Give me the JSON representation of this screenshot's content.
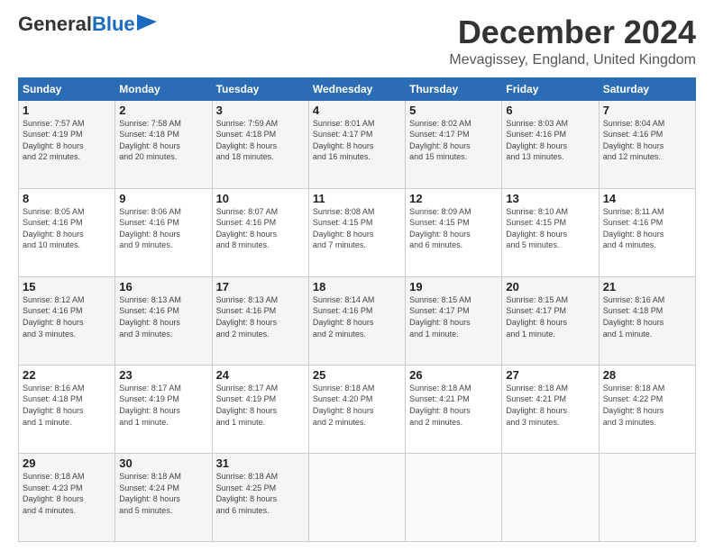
{
  "header": {
    "logo": {
      "general": "General",
      "blue": "Blue",
      "tagline": ""
    },
    "title": "December 2024",
    "location": "Mevagissey, England, United Kingdom"
  },
  "calendar": {
    "headers": [
      "Sunday",
      "Monday",
      "Tuesday",
      "Wednesday",
      "Thursday",
      "Friday",
      "Saturday"
    ],
    "weeks": [
      [
        {
          "day": "1",
          "info": "Sunrise: 7:57 AM\nSunset: 4:19 PM\nDaylight: 8 hours\nand 22 minutes."
        },
        {
          "day": "2",
          "info": "Sunrise: 7:58 AM\nSunset: 4:18 PM\nDaylight: 8 hours\nand 20 minutes."
        },
        {
          "day": "3",
          "info": "Sunrise: 7:59 AM\nSunset: 4:18 PM\nDaylight: 8 hours\nand 18 minutes."
        },
        {
          "day": "4",
          "info": "Sunrise: 8:01 AM\nSunset: 4:17 PM\nDaylight: 8 hours\nand 16 minutes."
        },
        {
          "day": "5",
          "info": "Sunrise: 8:02 AM\nSunset: 4:17 PM\nDaylight: 8 hours\nand 15 minutes."
        },
        {
          "day": "6",
          "info": "Sunrise: 8:03 AM\nSunset: 4:16 PM\nDaylight: 8 hours\nand 13 minutes."
        },
        {
          "day": "7",
          "info": "Sunrise: 8:04 AM\nSunset: 4:16 PM\nDaylight: 8 hours\nand 12 minutes."
        }
      ],
      [
        {
          "day": "8",
          "info": "Sunrise: 8:05 AM\nSunset: 4:16 PM\nDaylight: 8 hours\nand 10 minutes."
        },
        {
          "day": "9",
          "info": "Sunrise: 8:06 AM\nSunset: 4:16 PM\nDaylight: 8 hours\nand 9 minutes."
        },
        {
          "day": "10",
          "info": "Sunrise: 8:07 AM\nSunset: 4:16 PM\nDaylight: 8 hours\nand 8 minutes."
        },
        {
          "day": "11",
          "info": "Sunrise: 8:08 AM\nSunset: 4:15 PM\nDaylight: 8 hours\nand 7 minutes."
        },
        {
          "day": "12",
          "info": "Sunrise: 8:09 AM\nSunset: 4:15 PM\nDaylight: 8 hours\nand 6 minutes."
        },
        {
          "day": "13",
          "info": "Sunrise: 8:10 AM\nSunset: 4:15 PM\nDaylight: 8 hours\nand 5 minutes."
        },
        {
          "day": "14",
          "info": "Sunrise: 8:11 AM\nSunset: 4:16 PM\nDaylight: 8 hours\nand 4 minutes."
        }
      ],
      [
        {
          "day": "15",
          "info": "Sunrise: 8:12 AM\nSunset: 4:16 PM\nDaylight: 8 hours\nand 3 minutes."
        },
        {
          "day": "16",
          "info": "Sunrise: 8:13 AM\nSunset: 4:16 PM\nDaylight: 8 hours\nand 3 minutes."
        },
        {
          "day": "17",
          "info": "Sunrise: 8:13 AM\nSunset: 4:16 PM\nDaylight: 8 hours\nand 2 minutes."
        },
        {
          "day": "18",
          "info": "Sunrise: 8:14 AM\nSunset: 4:16 PM\nDaylight: 8 hours\nand 2 minutes."
        },
        {
          "day": "19",
          "info": "Sunrise: 8:15 AM\nSunset: 4:17 PM\nDaylight: 8 hours\nand 1 minute."
        },
        {
          "day": "20",
          "info": "Sunrise: 8:15 AM\nSunset: 4:17 PM\nDaylight: 8 hours\nand 1 minute."
        },
        {
          "day": "21",
          "info": "Sunrise: 8:16 AM\nSunset: 4:18 PM\nDaylight: 8 hours\nand 1 minute."
        }
      ],
      [
        {
          "day": "22",
          "info": "Sunrise: 8:16 AM\nSunset: 4:18 PM\nDaylight: 8 hours\nand 1 minute."
        },
        {
          "day": "23",
          "info": "Sunrise: 8:17 AM\nSunset: 4:19 PM\nDaylight: 8 hours\nand 1 minute."
        },
        {
          "day": "24",
          "info": "Sunrise: 8:17 AM\nSunset: 4:19 PM\nDaylight: 8 hours\nand 1 minute."
        },
        {
          "day": "25",
          "info": "Sunrise: 8:18 AM\nSunset: 4:20 PM\nDaylight: 8 hours\nand 2 minutes."
        },
        {
          "day": "26",
          "info": "Sunrise: 8:18 AM\nSunset: 4:21 PM\nDaylight: 8 hours\nand 2 minutes."
        },
        {
          "day": "27",
          "info": "Sunrise: 8:18 AM\nSunset: 4:21 PM\nDaylight: 8 hours\nand 3 minutes."
        },
        {
          "day": "28",
          "info": "Sunrise: 8:18 AM\nSunset: 4:22 PM\nDaylight: 8 hours\nand 3 minutes."
        }
      ],
      [
        {
          "day": "29",
          "info": "Sunrise: 8:18 AM\nSunset: 4:23 PM\nDaylight: 8 hours\nand 4 minutes."
        },
        {
          "day": "30",
          "info": "Sunrise: 8:18 AM\nSunset: 4:24 PM\nDaylight: 8 hours\nand 5 minutes."
        },
        {
          "day": "31",
          "info": "Sunrise: 8:18 AM\nSunset: 4:25 PM\nDaylight: 8 hours\nand 6 minutes."
        },
        {
          "day": "",
          "info": ""
        },
        {
          "day": "",
          "info": ""
        },
        {
          "day": "",
          "info": ""
        },
        {
          "day": "",
          "info": ""
        }
      ]
    ]
  }
}
